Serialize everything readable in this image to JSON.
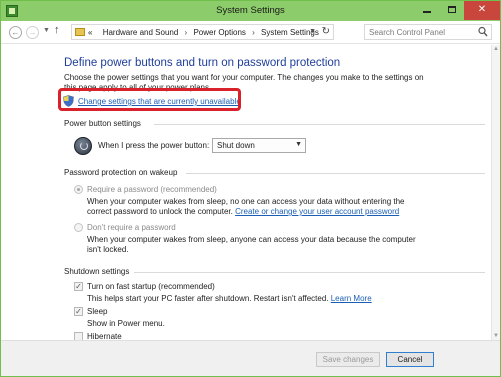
{
  "window": {
    "title": "System Settings",
    "close_label": "✕"
  },
  "nav": {
    "back_icon": "back-arrow-icon",
    "forward_icon": "forward-arrow-icon",
    "up_icon": "up-arrow-icon",
    "breadcrumb_prefix": "«",
    "breadcrumb": [
      "Hardware and Sound",
      "Power Options",
      "System Settings"
    ],
    "search_placeholder": "Search Control Panel"
  },
  "page": {
    "heading": "Define power buttons and turn on password protection",
    "intro": "Choose the power settings that you want for your computer. The changes you make to the settings on this page apply to all of your power plans.",
    "change_link": "Change settings that are currently unavailable",
    "highlight_color": "#d8212a"
  },
  "power_button": {
    "section_title": "Power button settings",
    "label": "When I press the power button:",
    "selected": "Shut down"
  },
  "password": {
    "section_title": "Password protection on wakeup",
    "require_label": "Require a password (recommended)",
    "require_desc": "When your computer wakes from sleep, no one can access your data without entering the correct password to unlock the computer.",
    "require_link": "Create or change your user account password",
    "norequire_label": "Don't require a password",
    "norequire_desc": "When your computer wakes from sleep, anyone can access your data because the computer isn't locked."
  },
  "shutdown": {
    "section_title": "Shutdown settings",
    "fast_startup_label": "Turn on fast startup (recommended)",
    "fast_startup_desc": "This helps start your PC faster after shutdown. Restart isn't affected.",
    "learn_more": "Learn More",
    "sleep_label": "Sleep",
    "sleep_desc": "Show in Power menu.",
    "hibernate_label": "Hibernate"
  },
  "footer": {
    "save_label": "Save changes",
    "cancel_label": "Cancel"
  }
}
